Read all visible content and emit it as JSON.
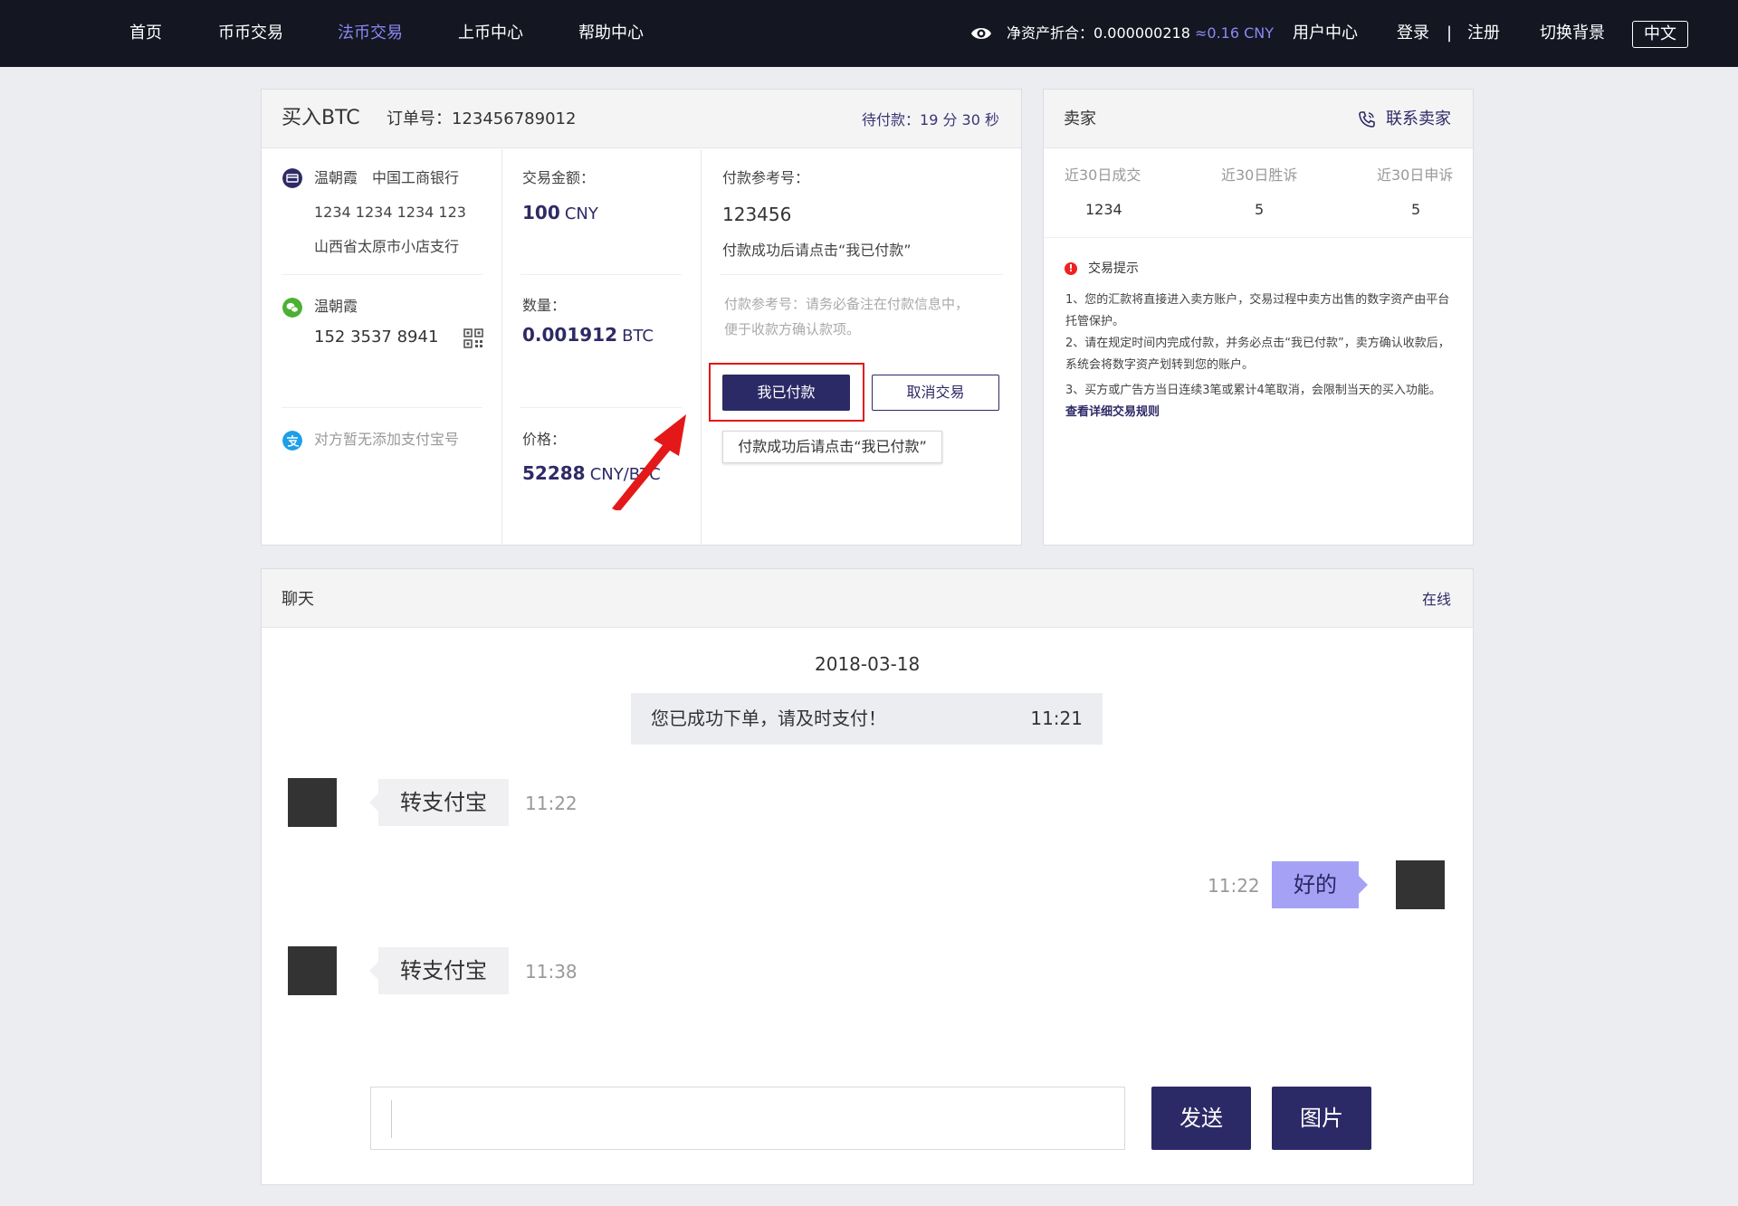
{
  "nav": {
    "items": [
      "首页",
      "币币交易",
      "法币交易",
      "上币中心",
      "帮助中心"
    ],
    "active_index": 2,
    "asset_label": "净资产折合：",
    "asset_value": "0.000000218",
    "asset_cny": "≈0.16 CNY",
    "user_center": "用户中心",
    "login": "登录",
    "separator": "|",
    "register": "注册",
    "switch_bg": "切换背景",
    "lang": "中文"
  },
  "order": {
    "title": "买入BTC",
    "order_no": "订单号：123456789012",
    "countdown": "待付款：19 分 30 秒",
    "bank": {
      "name": "温朝霞",
      "bank_name": "中国工商银行",
      "account": "1234 1234 1234 123",
      "branch": "山西省太原市小店支行"
    },
    "wechat": {
      "name": "温朝霞",
      "phone": "152 3537 8941"
    },
    "alipay_note": "对方暂无添加支付宝号",
    "amount_label": "交易金额：",
    "amount_value": "100",
    "amount_unit": "CNY",
    "qty_label": "数量：",
    "qty_value": "0.001912",
    "qty_unit": "BTC",
    "price_label": "价格：",
    "price_value": "52288",
    "price_unit": "CNY/BTC",
    "ref_label": "付款参考号：",
    "ref_value": "123456",
    "ref_hint": "付款成功后请点击“我已付款”",
    "ref_note_1": "付款参考号：请务必备注在付款信息中，",
    "ref_note_2": "便于收款方确认款项。",
    "btn_paid": "我已付款",
    "btn_cancel": "取消交易",
    "tooltip": "付款成功后请点击“我已付款”"
  },
  "seller": {
    "title": "卖家",
    "contact": "联系卖家",
    "stats": [
      {
        "label": "近30日成交",
        "value": "1234"
      },
      {
        "label": "近30日胜诉",
        "value": "5"
      },
      {
        "label": "近30日申诉",
        "value": "5"
      }
    ],
    "tips_title": "交易提示",
    "tip1": "1、您的汇款将直接进入卖方账户，交易过程中卖方出售的数字资产由平台托管保护。",
    "tip2": "2、请在规定时间内完成付款，并务必点击“我已付款”，卖方确认收款后，系统会将数字资产划转到您的账户。",
    "tip3_prefix": "3、买方或广告方当日连续3笔或累计4笔取消，会限制当天的买入功能。",
    "tip3_link": "查看详细交易规则"
  },
  "chat": {
    "title": "聊天",
    "status": "在线",
    "date": "2018-03-18",
    "system_msg": "您已成功下单，请及时支付！",
    "system_time": "11:21",
    "messages": [
      {
        "side": "left",
        "text": "转支付宝",
        "time": "11:22"
      },
      {
        "side": "right",
        "text": "好的",
        "time": "11:22"
      },
      {
        "side": "left",
        "text": "转支付宝",
        "time": "11:38"
      }
    ],
    "input_value": "",
    "send": "发送",
    "image": "图片"
  },
  "colors": {
    "nav_bg": "#141622",
    "accent": "#2c2a66",
    "active_nav": "#8c88f3",
    "highlight_box": "#e41818",
    "wechat_green": "#4cb032",
    "alipay_blue": "#1e9fe8"
  },
  "icons": [
    "eye-icon",
    "bank-card-icon",
    "wechat-icon",
    "qrcode-icon",
    "alipay-icon",
    "phone-icon",
    "alert-icon",
    "pointer-arrow-icon"
  ]
}
